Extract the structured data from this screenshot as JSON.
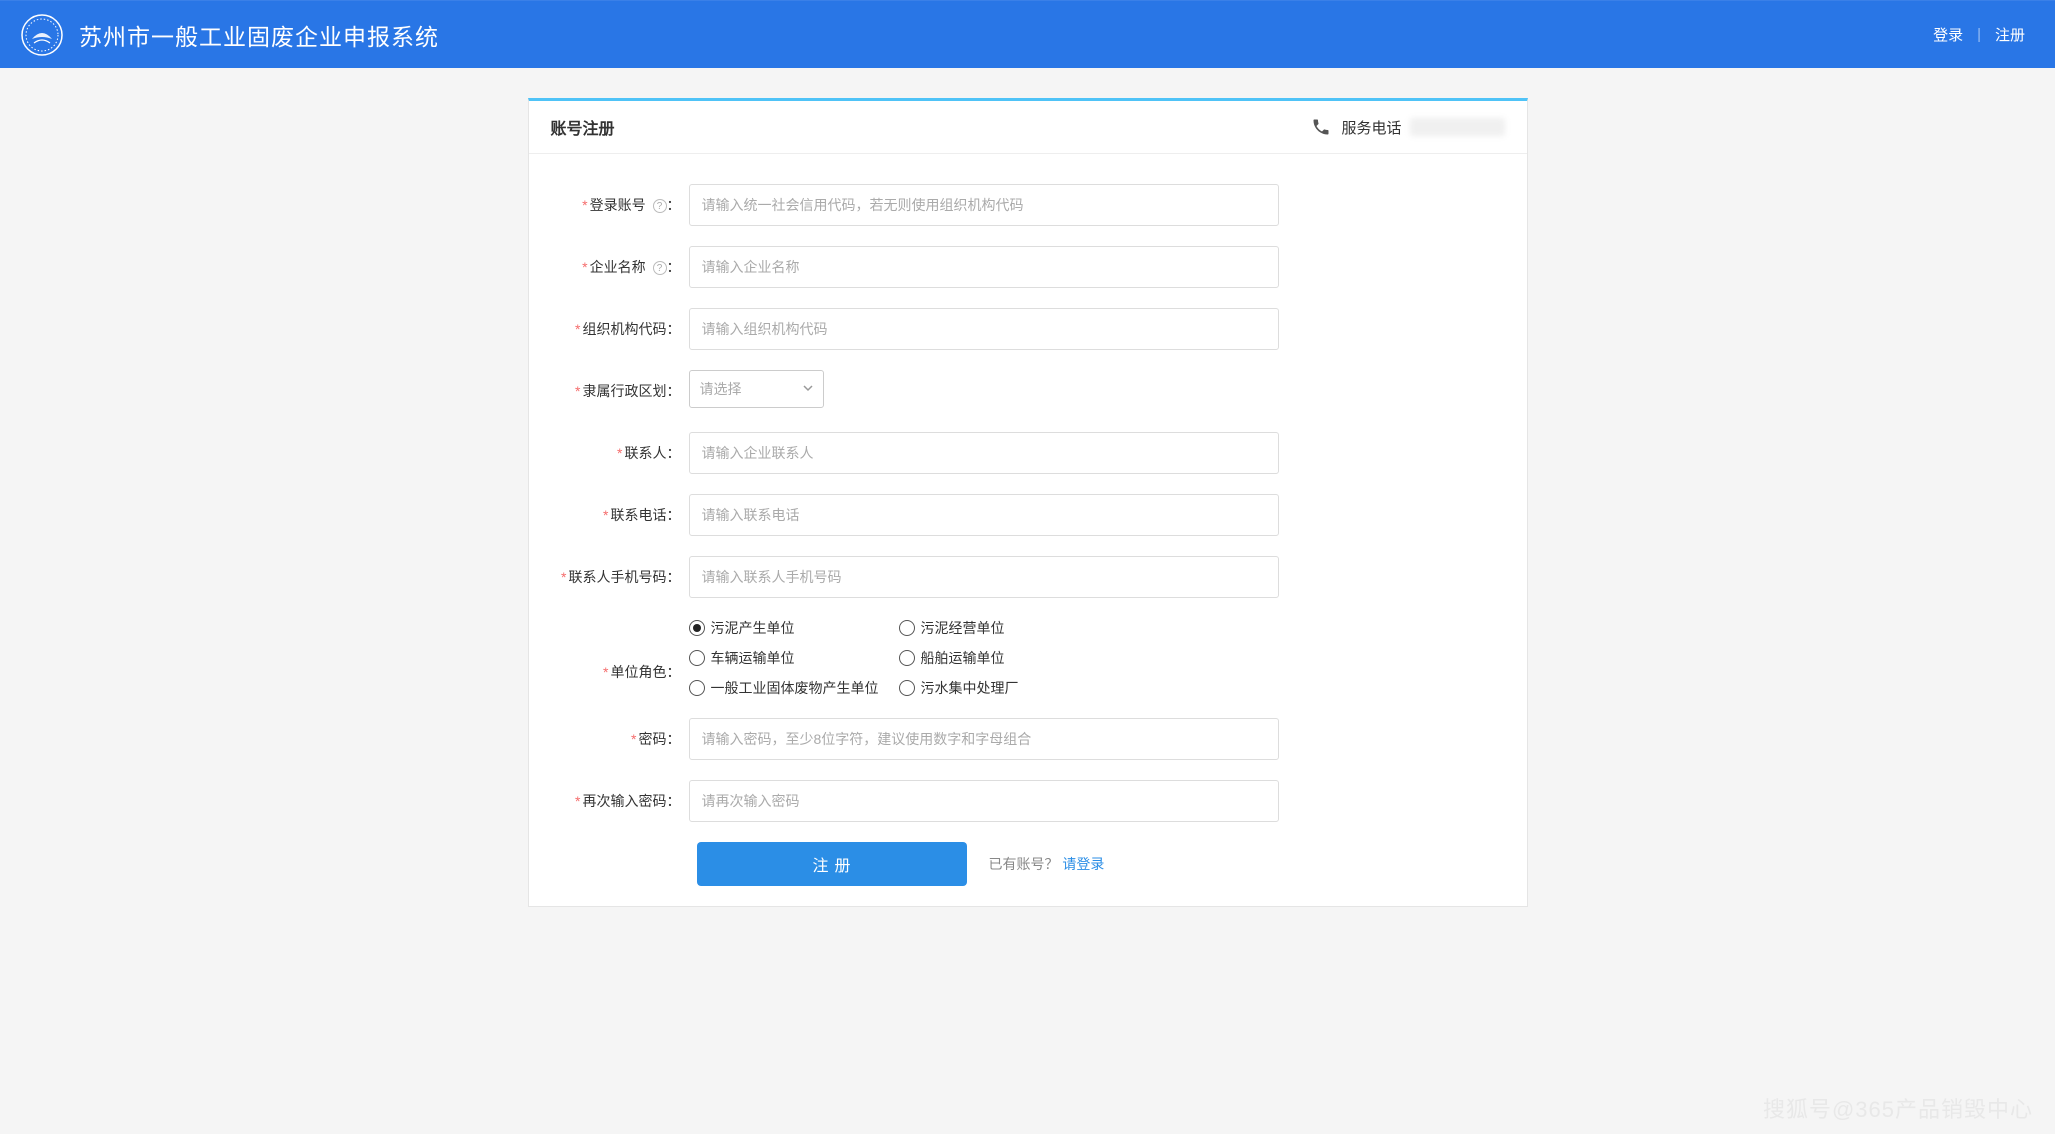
{
  "header": {
    "title": "苏州市一般工业固废企业申报系统",
    "login": "登录",
    "register": "注册"
  },
  "panel": {
    "title": "账号注册",
    "service_label": "服务电话"
  },
  "form": {
    "login_account": {
      "label": "登录账号",
      "placeholder": "请输入统一社会信用代码，若无则使用组织机构代码"
    },
    "company_name": {
      "label": "企业名称",
      "placeholder": "请输入企业名称"
    },
    "org_code": {
      "label": "组织机构代码",
      "placeholder": "请输入组织机构代码"
    },
    "region": {
      "label": "隶属行政区划",
      "placeholder": "请选择"
    },
    "contact": {
      "label": "联系人",
      "placeholder": "请输入企业联系人"
    },
    "phone": {
      "label": "联系电话",
      "placeholder": "请输入联系电话"
    },
    "mobile": {
      "label": "联系人手机号码",
      "placeholder": "请输入联系人手机号码"
    },
    "role": {
      "label": "单位角色",
      "options": [
        "污泥产生单位",
        "污泥经营单位",
        "车辆运输单位",
        "船舶运输单位",
        "一般工业固体废物产生单位",
        "污水集中处理厂"
      ],
      "selected": 0
    },
    "password": {
      "label": "密码",
      "placeholder": "请输入密码，至少8位字符，建议使用数字和字母组合"
    },
    "password_confirm": {
      "label": "再次输入密码",
      "placeholder": "请再次输入密码"
    }
  },
  "actions": {
    "submit": "注册",
    "have_account": "已有账号？",
    "login_link": "请登录"
  },
  "watermark": "搜狐号@365产品销毁中心"
}
